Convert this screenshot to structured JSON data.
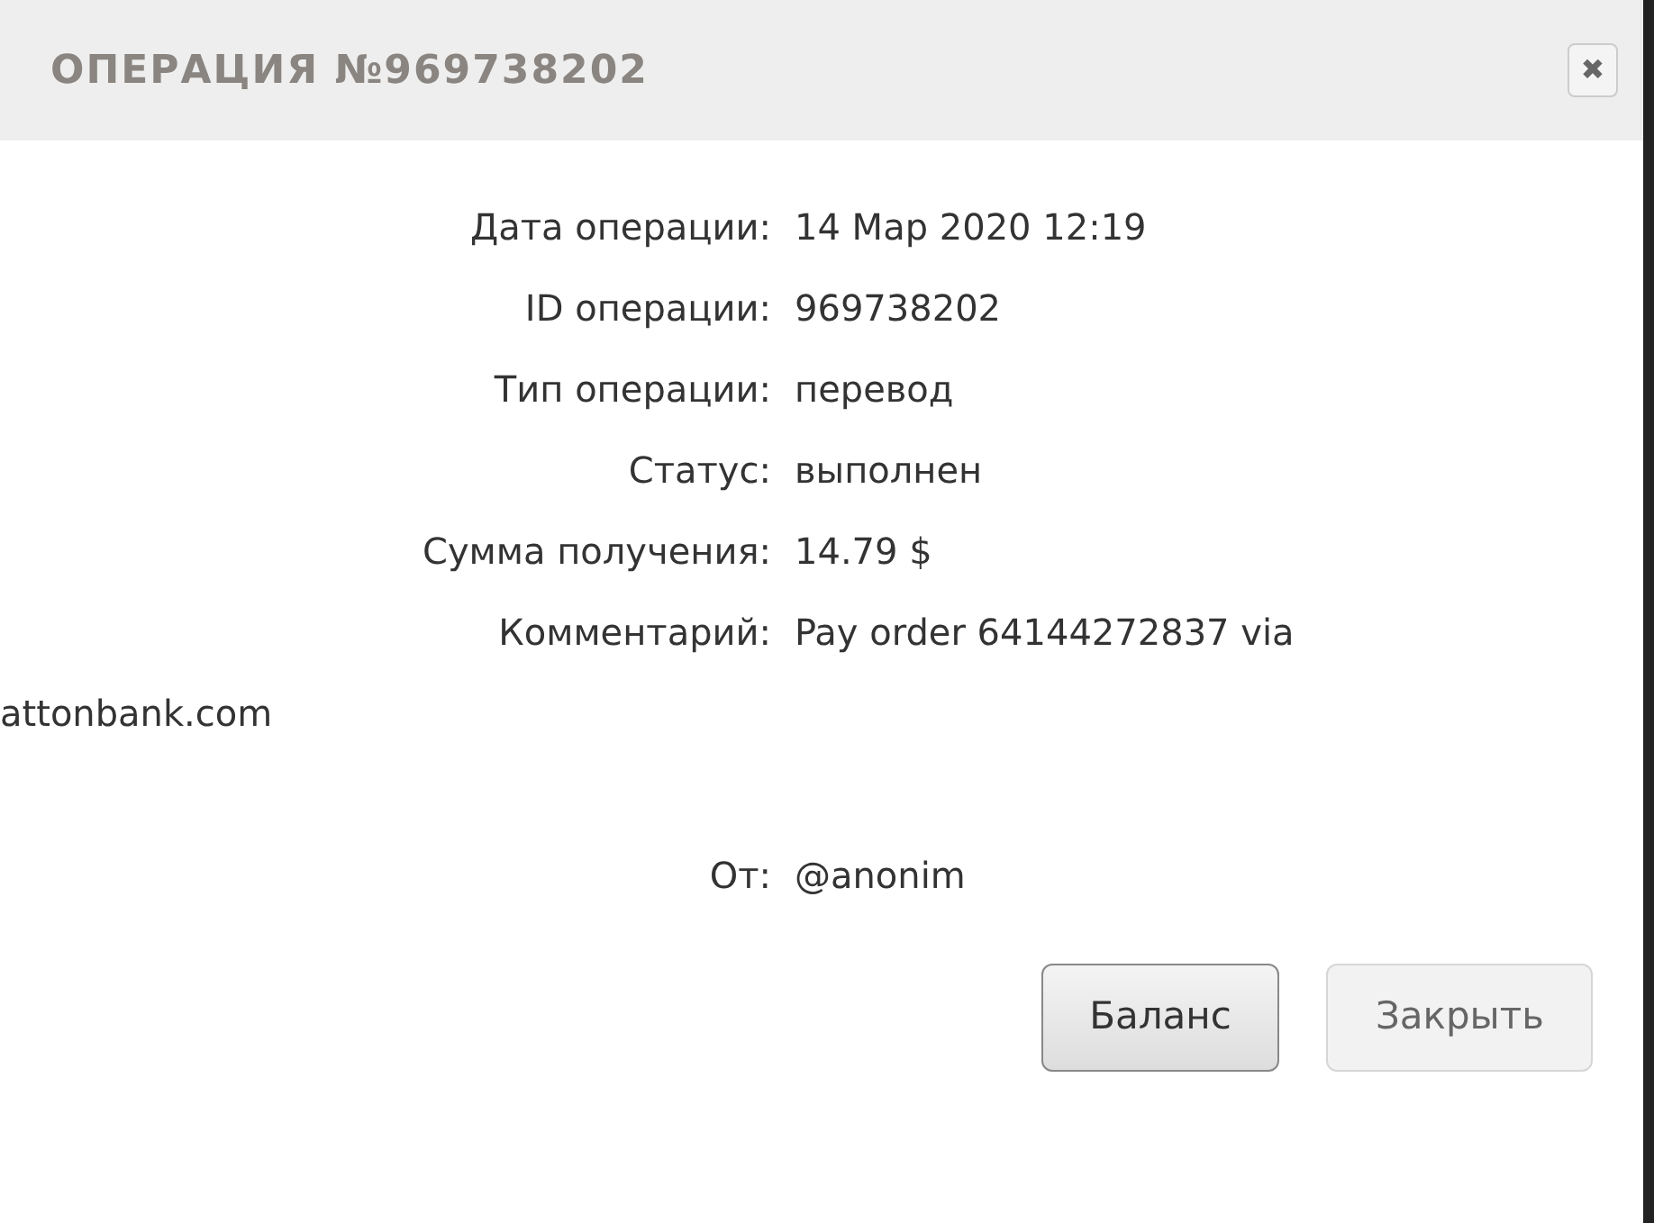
{
  "dialog": {
    "title": "ОПЕРАЦИЯ №969738202",
    "close_icon": "✖"
  },
  "fields": [
    {
      "label": "Дата операции:",
      "value": "14 Мар 2020 12:19"
    },
    {
      "label": "ID операции:",
      "value": "969738202"
    },
    {
      "label": "Тип операции:",
      "value": "перевод"
    },
    {
      "label": "Статус:",
      "value": "выполнен"
    },
    {
      "label": "Сумма получения:",
      "value": "14.79 $"
    },
    {
      "label": "Комментарий:",
      "lines": [
        "Pay order 64144272837 via",
        "attonbank.com"
      ]
    }
  ],
  "sender": {
    "label": "От:",
    "value": "@anonim"
  },
  "buttons": [
    {
      "label": "Баланс",
      "kind": "primary"
    },
    {
      "label": "Закрыть",
      "kind": "secondary"
    }
  ]
}
